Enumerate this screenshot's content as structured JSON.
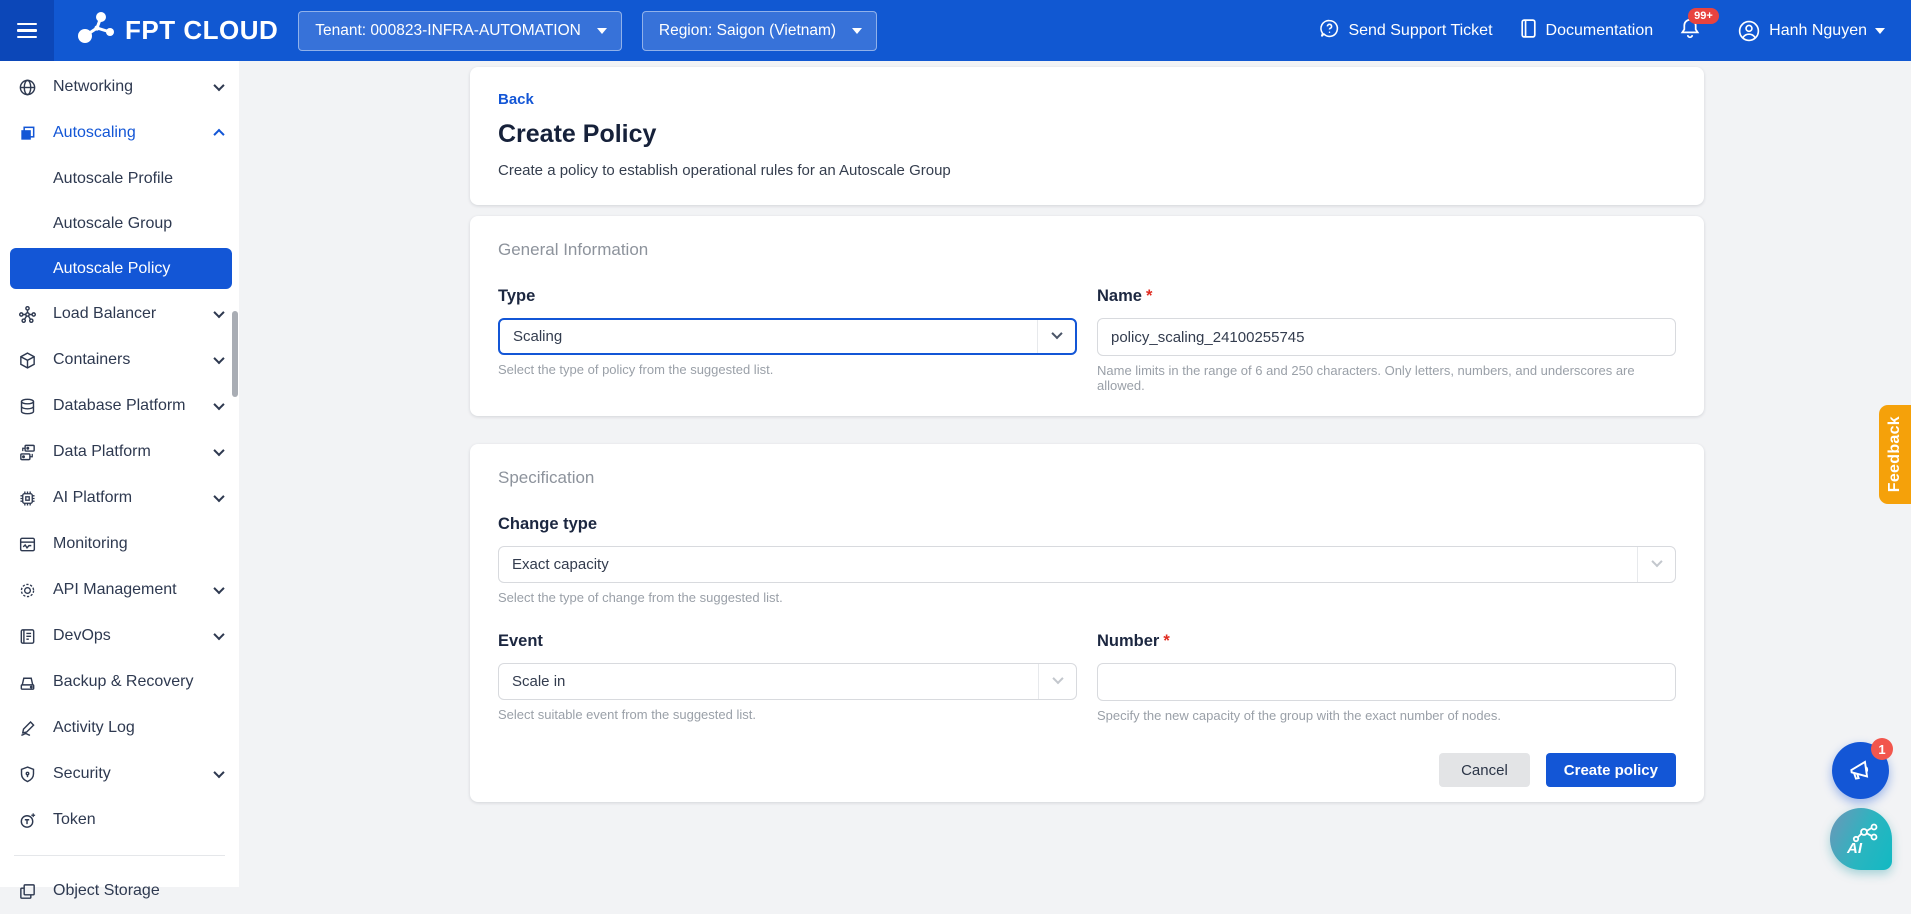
{
  "navbar": {
    "logo_text": "FPT CLOUD",
    "tenant": "Tenant: 000823-INFRA-AUTOMATION",
    "region": "Region: Saigon (Vietnam)",
    "support_label": "Send Support Ticket",
    "docs_label": "Documentation",
    "notification_badge": "99+",
    "user_name": "Hanh Nguyen"
  },
  "sidebar": {
    "items": [
      {
        "label": "Networking",
        "chevron": "down"
      },
      {
        "label": "Autoscaling",
        "chevron": "up",
        "active": true
      },
      {
        "label": "Load Balancer",
        "chevron": "down"
      },
      {
        "label": "Containers",
        "chevron": "down"
      },
      {
        "label": "Database Platform",
        "chevron": "down"
      },
      {
        "label": "Data Platform",
        "chevron": "down"
      },
      {
        "label": "AI Platform",
        "chevron": "down"
      },
      {
        "label": "Monitoring"
      },
      {
        "label": "API Management",
        "chevron": "down"
      },
      {
        "label": "DevOps",
        "chevron": "down"
      },
      {
        "label": "Backup & Recovery"
      },
      {
        "label": "Activity Log"
      },
      {
        "label": "Security",
        "chevron": "down"
      },
      {
        "label": "Token"
      },
      {
        "label": "Object Storage"
      }
    ],
    "autoscaling_children": [
      {
        "label": "Autoscale Profile",
        "selected": false
      },
      {
        "label": "Autoscale Group",
        "selected": false
      },
      {
        "label": "Autoscale Policy",
        "selected": true
      }
    ]
  },
  "page": {
    "back_label": "Back",
    "title": "Create Policy",
    "subtitle": "Create a policy to establish operational rules for an Autoscale Group"
  },
  "general": {
    "section_title": "General Information",
    "type_label": "Type",
    "type_value": "Scaling",
    "type_help": "Select the type of policy from the suggested list.",
    "name_label": "Name",
    "required_mark": "*",
    "name_value": "policy_scaling_24100255745",
    "name_help": "Name limits in the range of 6 and 250 characters. Only letters, numbers, and underscores are allowed."
  },
  "spec": {
    "section_title": "Specification",
    "change_type_label": "Change type",
    "change_type_value": "Exact capacity",
    "change_type_help": "Select the type of change from the suggested list.",
    "event_label": "Event",
    "event_value": "Scale in",
    "event_help": "Select suitable event from the suggested list.",
    "number_label": "Number",
    "number_required_mark": "*",
    "number_value": "",
    "number_help": "Specify the new capacity of the group with the exact number of nodes.",
    "cancel_label": "Cancel",
    "submit_label": "Create policy"
  },
  "floating": {
    "feedback_label": "Feedback",
    "megaphone_badge": "1",
    "ai_label": "AI"
  },
  "colors": {
    "navbar_blue": "#1158d2",
    "accent_blue": "#1356d6",
    "feedback_orange": "#f5a10a",
    "badge_red": "#e8433f",
    "required_red": "#e02b20"
  }
}
